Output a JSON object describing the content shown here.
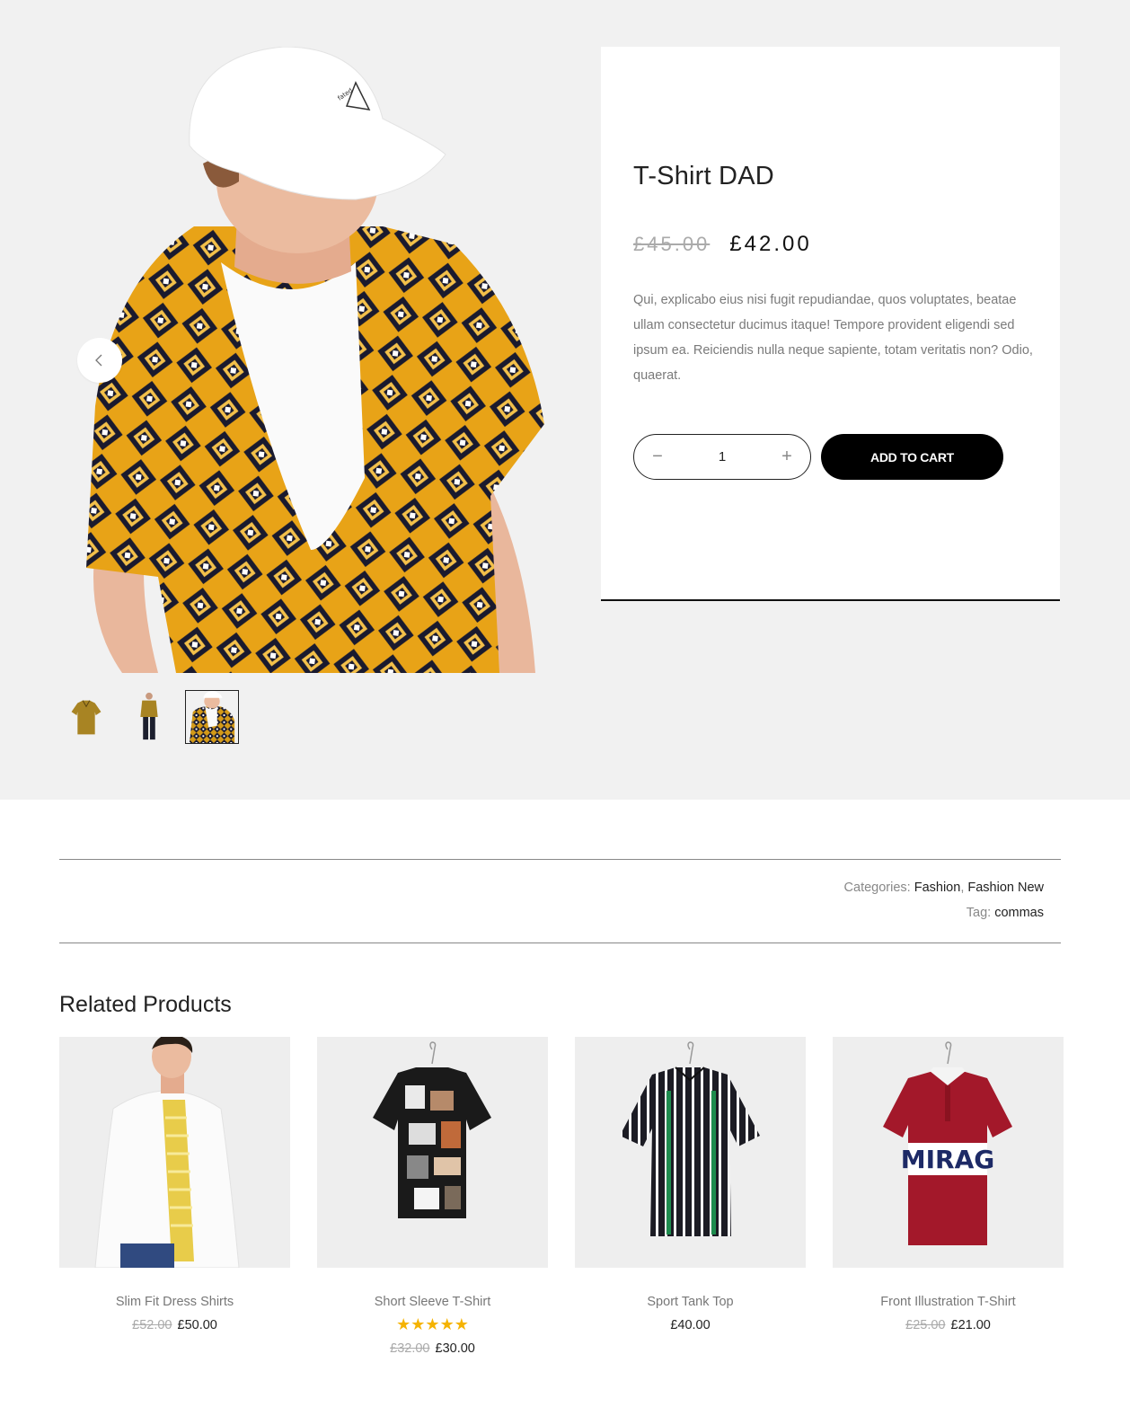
{
  "product": {
    "title": "T-Shirt DAD",
    "price_old": "£45.00",
    "price_new": "£42.00",
    "description": "Qui, explicabo eius nisi fugit repudiandae, quos voluptates, beatae ullam consectetur ducimus itaque! Tempore provident eligendi sed ipsum ea. Reiciendis nulla neque sapiente, totam veritatis non? Odio, quaerat.",
    "quantity": "1",
    "add_to_cart_label": "ADD TO CART",
    "qty_minus": "−",
    "qty_plus": "+"
  },
  "gallery": {
    "prev_icon": "chevron-left-icon",
    "thumbnails": [
      "shirt-front",
      "model-full",
      "model-closeup"
    ],
    "active_thumbnail": 2
  },
  "meta": {
    "categories_label": "Categories:",
    "category_1": "Fashion",
    "category_sep": ",",
    "category_2": "Fashion New",
    "tag_label": "Tag:",
    "tag": "commas"
  },
  "related": {
    "title": "Related Products",
    "items": [
      {
        "name": "Slim Fit Dress Shirts",
        "price_old": "£52.00",
        "price_new": "£50.00",
        "rating": ""
      },
      {
        "name": "Short Sleeve T-Shirt",
        "price_old": "£32.00",
        "price_new": "£30.00",
        "rating": "★★★★★"
      },
      {
        "name": "Sport Tank Top",
        "price_old": "",
        "price_new": "£40.00",
        "rating": ""
      },
      {
        "name": "Front Illustration T-Shirt",
        "price_old": "£25.00",
        "price_new": "£21.00",
        "rating": ""
      }
    ]
  },
  "colors": {
    "hero_bg": "#f1f1f1",
    "button_bg": "#000000",
    "star": "#f5b301",
    "shirt_yellow": "#e8a317",
    "polo_red": "#a3182a"
  }
}
